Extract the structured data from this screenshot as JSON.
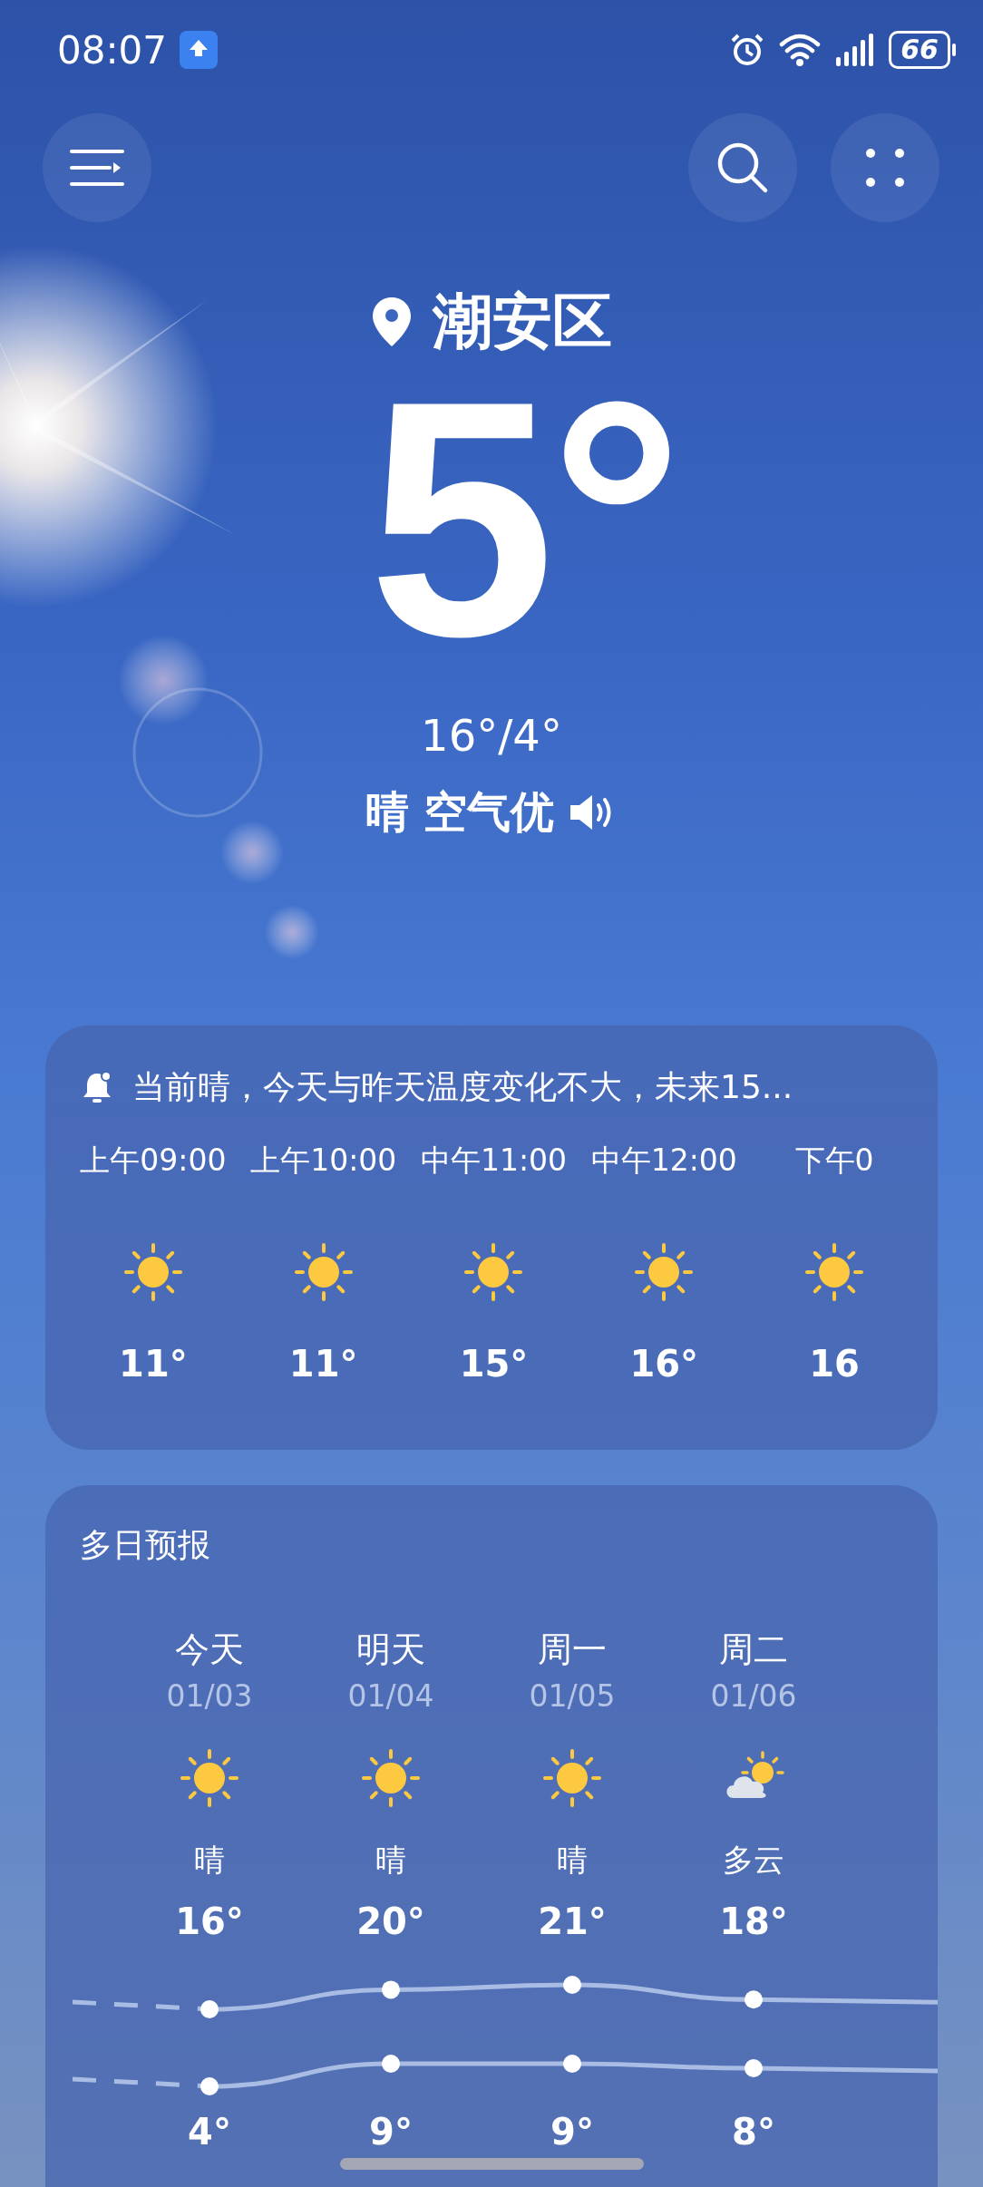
{
  "status_bar": {
    "time": "08:07",
    "battery": "66"
  },
  "location": "潮安区",
  "current": {
    "temperature": "5°",
    "range": "16°/4°",
    "condition": "晴",
    "air": "空气优"
  },
  "hourly": {
    "alert": "当前晴，今天与昨天温度变化不大，未来15...",
    "hours": [
      {
        "time": "上午09:00",
        "kind": "sunny",
        "temp": "11°"
      },
      {
        "time": "上午10:00",
        "kind": "sunny",
        "temp": "11°"
      },
      {
        "time": "中午11:00",
        "kind": "sunny",
        "temp": "15°"
      },
      {
        "time": "中午12:00",
        "kind": "sunny",
        "temp": "16°"
      },
      {
        "time": "下午0",
        "kind": "sunny",
        "temp": "16"
      }
    ]
  },
  "daily": {
    "title": "多日预报",
    "days": [
      {
        "day": "今天",
        "date": "01/03",
        "kind": "sunny",
        "condition": "晴",
        "high": "16°",
        "low": "4°"
      },
      {
        "day": "明天",
        "date": "01/04",
        "kind": "sunny",
        "condition": "晴",
        "high": "20°",
        "low": "9°"
      },
      {
        "day": "周一",
        "date": "01/05",
        "kind": "sunny",
        "condition": "晴",
        "high": "21°",
        "low": "9°"
      },
      {
        "day": "周二",
        "date": "01/06",
        "kind": "partly_cloudy",
        "condition": "多云",
        "high": "18°",
        "low": "8°"
      }
    ]
  }
}
